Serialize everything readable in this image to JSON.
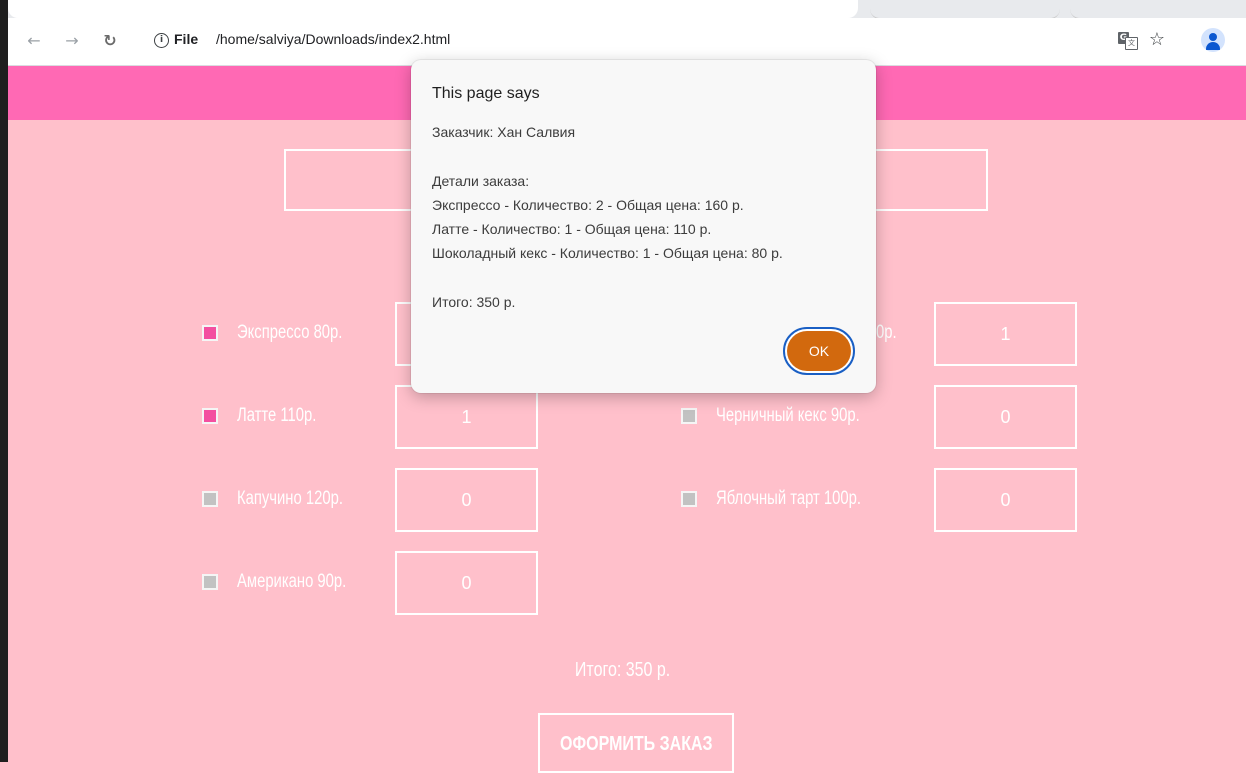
{
  "browser": {
    "back_icon": "←",
    "forward_icon": "→",
    "reload_icon": "↻",
    "info_icon": "i",
    "scheme_label": "File",
    "url": "/home/salviya/Downloads/index2.html",
    "star_icon": "☆"
  },
  "colors": {
    "page_background": "#ffc0cb",
    "header": "#ff69b4",
    "checked": "#f34fa0",
    "unchecked": "#c2c2c2",
    "ok_button": "#d2690e",
    "ok_focus_ring": "#1a5fc4"
  },
  "menu": {
    "left": [
      {
        "label": "Экспрессо 80р.",
        "checked": true,
        "quantity": ""
      },
      {
        "label": "Латте 110р.",
        "checked": true,
        "quantity": "1"
      },
      {
        "label": "Капучино 120р.",
        "checked": false,
        "quantity": "0"
      },
      {
        "label": "Американо 90р.",
        "checked": false,
        "quantity": "0"
      }
    ],
    "right": [
      {
        "label": "0р.",
        "checked": null,
        "quantity": "1"
      },
      {
        "label": "Черничный кекс 90р.",
        "checked": false,
        "quantity": "0"
      },
      {
        "label": "Яблочный тарт 100р.",
        "checked": false,
        "quantity": "0"
      }
    ]
  },
  "total_label": "Итого: 350 р.",
  "order_button_label": "ОФОРМИТЬ ЗАКАЗ",
  "dialog": {
    "title": "This page says",
    "message": "Заказчик: Хан Салвия\n\nДетали заказа:\nЭкспрессо - Количество: 2 - Общая цена: 160 р.\nЛатте - Количество: 1 - Общая цена: 110 р.\nШоколадный кекс - Количество: 1 - Общая цена: 80 р.\n\nИтого: 350 р.",
    "ok_label": "OK"
  }
}
